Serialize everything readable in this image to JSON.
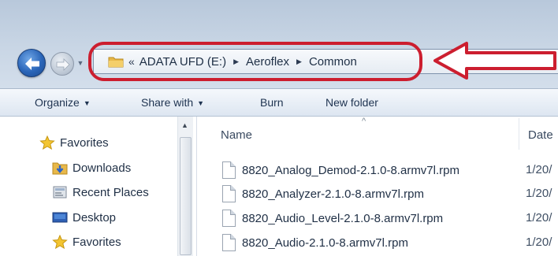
{
  "address": {
    "overflow_chevron": "«",
    "crumbs": [
      "ADATA UFD (E:)",
      "Aeroflex",
      "Common"
    ]
  },
  "toolbar": {
    "organize": "Organize",
    "share_with": "Share with",
    "burn": "Burn",
    "new_folder": "New folder"
  },
  "nav": {
    "items": [
      {
        "label": "Favorites",
        "icon": "star-icon"
      },
      {
        "label": "Downloads",
        "icon": "downloads-folder-icon"
      },
      {
        "label": "Recent Places",
        "icon": "recent-places-icon"
      },
      {
        "label": "Desktop",
        "icon": "desktop-icon"
      },
      {
        "label": "Favorites",
        "icon": "star-icon"
      }
    ]
  },
  "columns": {
    "name": "Name",
    "date": "Date"
  },
  "files": [
    {
      "name": "8820_Analog_Demod-2.1.0-8.armv7l.rpm",
      "date": "1/20/"
    },
    {
      "name": "8820_Analyzer-2.1.0-8.armv7l.rpm",
      "date": "1/20/"
    },
    {
      "name": "8820_Audio_Level-2.1.0-8.armv7l.rpm",
      "date": "1/20/"
    },
    {
      "name": "8820_Audio-2.1.0-8.armv7l.rpm",
      "date": "1/20/"
    }
  ],
  "colors": {
    "highlight": "#cc1e2f",
    "nav_blue": "#2a65b8"
  }
}
